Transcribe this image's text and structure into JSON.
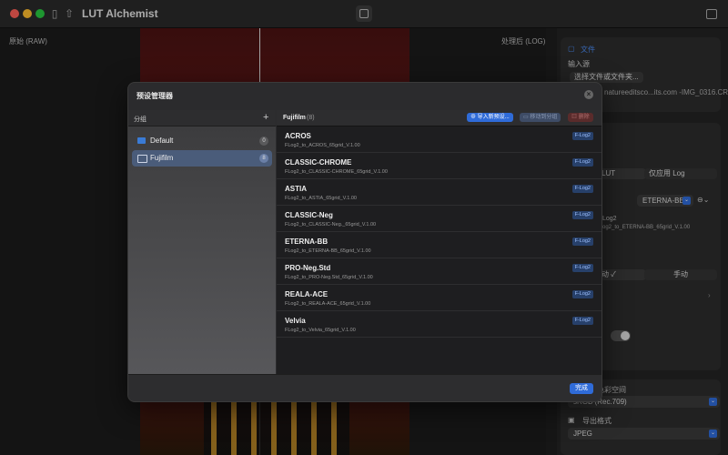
{
  "app": {
    "title": "LUT Alchemist"
  },
  "workspace": {
    "left_label": "原始 (RAW)",
    "right_label": "处理后 (LOG)"
  },
  "sidebar": {
    "file_section": "文件",
    "input_source_label": "输入源",
    "choose_button": "选择文件或文件夹...",
    "file_path": "natureeditsco...its.com -IMG_0316.CR2",
    "lut_only_button": "LUT",
    "log_only_button": "仅应用 Log",
    "preset_select": "ETERNA-BB",
    "log_line1": "Log2",
    "log_line2": "og2_to_ETERNA-BB_65grid_V.1.00",
    "mode_auto": "动 ✓",
    "mode_manual": "手动",
    "output_color_space_label": "输出色彩空间",
    "color_space_value": "sRGB (Rec.709)",
    "export_format_label": "导出格式",
    "format_value": "JPEG"
  },
  "modal": {
    "title": "预设管理器",
    "groups_header": "分组",
    "add_group": "+",
    "groups": [
      {
        "name": "Default",
        "count": "0",
        "color": "#3a7bd5"
      },
      {
        "name": "Fujifilm",
        "count": "8",
        "color": "#aab4c8"
      }
    ],
    "current_group": "Fujifilm",
    "current_count": "(8)",
    "import_button": "导入新预设...",
    "move_button": "移动到分组",
    "delete_button": "删除",
    "presets": [
      {
        "name": "ACROS",
        "file": "FLog2_to_ACROS_65grid_V.1.00",
        "tag": "F-Log2"
      },
      {
        "name": "CLASSIC-CHROME",
        "file": "FLog2_to_CLASSIC-CHROME_65grid_V.1.00",
        "tag": "F-Log2"
      },
      {
        "name": "ASTIA",
        "file": "FLog2_to_ASTIA_65grid_V.1.00",
        "tag": "F-Log2"
      },
      {
        "name": "CLASSIC-Neg",
        "file": "FLog2_to_CLASSIC-Neg._65grid_V.1.00",
        "tag": "F-Log2"
      },
      {
        "name": "ETERNA-BB",
        "file": "FLog2_to_ETERNA-BB_65grid_V.1.00",
        "tag": "F-Log2"
      },
      {
        "name": "PRO-Neg.Std",
        "file": "FLog2_to_PRO-Neg.Std_65grid_V.1.00",
        "tag": "F-Log2"
      },
      {
        "name": "REALA-ACE",
        "file": "FLog2_to_REALA-ACE_65grid_V.1.00",
        "tag": "F-Log2"
      },
      {
        "name": "Velvia",
        "file": "FLog2_to_Velvia_65grid_V.1.00",
        "tag": "F-Log2"
      }
    ],
    "done_button": "完成"
  },
  "colors": {
    "accent": "#2f6bd8",
    "close": "#ff5f57",
    "minimize": "#febc2e",
    "zoom": "#28c840"
  }
}
